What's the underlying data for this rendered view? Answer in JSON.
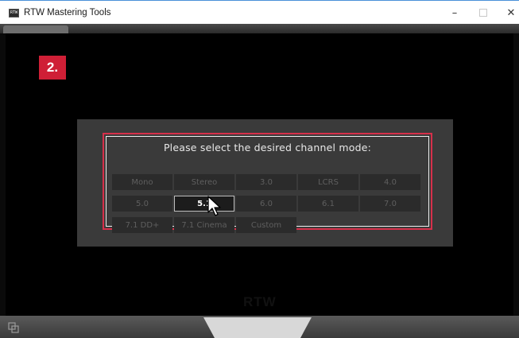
{
  "window": {
    "title": "RTW Mastering Tools",
    "icon_name": "rtw-app-icon",
    "icon_text": "RTW",
    "controls": {
      "minimize": "–",
      "close": "✕"
    }
  },
  "step_badge": "2.",
  "dialog": {
    "prompt": "Please select the desired channel mode:",
    "modes": [
      {
        "label": "Mono",
        "selected": false
      },
      {
        "label": "Stereo",
        "selected": false
      },
      {
        "label": "3.0",
        "selected": false
      },
      {
        "label": "LCRS",
        "selected": false
      },
      {
        "label": "4.0",
        "selected": false
      },
      {
        "label": "5.0",
        "selected": false
      },
      {
        "label": "5.1",
        "selected": true
      },
      {
        "label": "6.0",
        "selected": false
      },
      {
        "label": "6.1",
        "selected": false
      },
      {
        "label": "7.0",
        "selected": false
      },
      {
        "label": "7.1 DD+",
        "selected": false
      },
      {
        "label": "7.1 Cinema",
        "selected": false
      },
      {
        "label": "Custom",
        "selected": false
      }
    ]
  },
  "footer": {
    "logo": "RTW"
  },
  "colors": {
    "accent_red": "#cf1f36",
    "dialog_bg": "#3a3a3a",
    "button_bg": "#2b2b2b"
  }
}
